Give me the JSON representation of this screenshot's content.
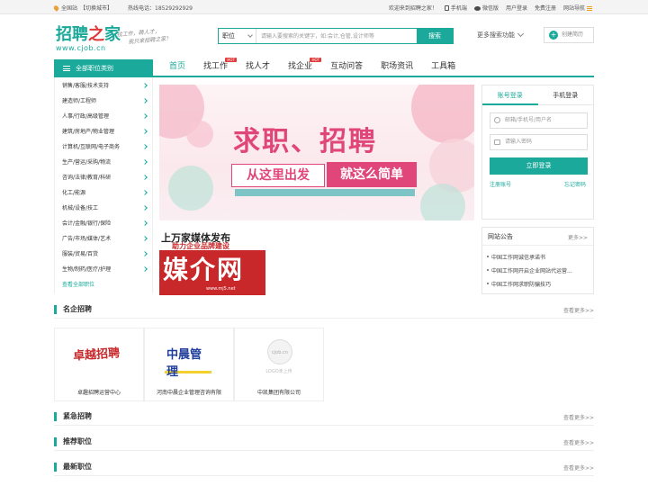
{
  "topbar": {
    "station": "全国站",
    "switch_city": "【切换城市】",
    "hotline": "热线电话：18529292929",
    "welcome": "欢迎来到招聘之家！",
    "mobile": "手机端",
    "wechat": "微信版",
    "login": "用户登录",
    "register": "免费注册",
    "site_nav": "网站导航"
  },
  "header": {
    "logo_cn_a": "招聘",
    "logo_cn_b": "之",
    "logo_cn_c": "家",
    "logo_url": "www.cjob.cn",
    "slogan_1": "找工作，聘人才，",
    "slogan_2": "我只来招聘之家！",
    "search_type": "职位",
    "search_placeholder": "请输入要搜索的关键字，如:会计,仓管,设计师等",
    "search_button": "搜索",
    "more_search": "更多搜索功能",
    "create_resume": "创建简历"
  },
  "nav": {
    "all_categories": "全部职位类别",
    "items": [
      {
        "label": "首页",
        "hot": ""
      },
      {
        "label": "找工作",
        "hot": "HOT"
      },
      {
        "label": "找人才",
        "hot": ""
      },
      {
        "label": "找企业",
        "hot": "HOT"
      },
      {
        "label": "互动问答",
        "hot": ""
      },
      {
        "label": "职场资讯",
        "hot": ""
      },
      {
        "label": "工具箱",
        "hot": ""
      }
    ]
  },
  "categories": [
    "销售/客服/技术支持",
    "建造师/工程师",
    "人事/行政/高级管理",
    "建筑/房地产/物业管理",
    "计算机/互联网/电子商务",
    "生产/营运/采购/物流",
    "咨询/法律/教育/科研",
    "化工/能源",
    "机械/设备/技工",
    "会计/金融/银行/保险",
    "广告/市场/媒体/艺术",
    "服装/贸易/百货",
    "生物/制药/医疗/护理"
  ],
  "categories_all": "查看全部职位",
  "banner": {
    "title": "求职、招聘",
    "sub1": "从这里出发",
    "sub2": "就这么简单"
  },
  "ad": {
    "line1": "上万家媒体发布",
    "line2": "助力企业品牌建设",
    "big": "媒介网",
    "url": "www.mj5.net"
  },
  "login": {
    "tab_account": "账号登录",
    "tab_mobile": "手机登录",
    "user_placeholder": "邮箱/手机号/用户名",
    "pwd_placeholder": "请输入密码",
    "submit": "立即登录",
    "register": "注册账号",
    "forgot": "忘记密码"
  },
  "notice": {
    "title": "网站公告",
    "more": "更多>>",
    "items": [
      "中国工作网诚信承诺书",
      "中国工作网开启企业网站代运营...",
      "中国工作网求职防骗技巧"
    ]
  },
  "sections": {
    "famous": {
      "title": "名企招聘",
      "more": "查看更多>>"
    },
    "urgent": {
      "title": "紧急招聘",
      "more": "查看更多>>"
    },
    "recommend": {
      "title": "推荐职位",
      "more": "查看更多>>"
    },
    "latest": {
      "title": "最新职位",
      "more": "查看更多>>"
    }
  },
  "companies": [
    {
      "name": "卓趣招聘运营中心",
      "logo_text": "卓越招聘"
    },
    {
      "name": "河南中晨企业管理咨询有限",
      "logo_text": "中晨管理"
    },
    {
      "name": "中凯集团有限公司",
      "logo_text": "cjob.cn",
      "logo_sub": "LOGO未上传"
    }
  ],
  "colors": {
    "brand": "#1aa99a",
    "accent": "#e0467a",
    "hot": "#e03a3a"
  }
}
